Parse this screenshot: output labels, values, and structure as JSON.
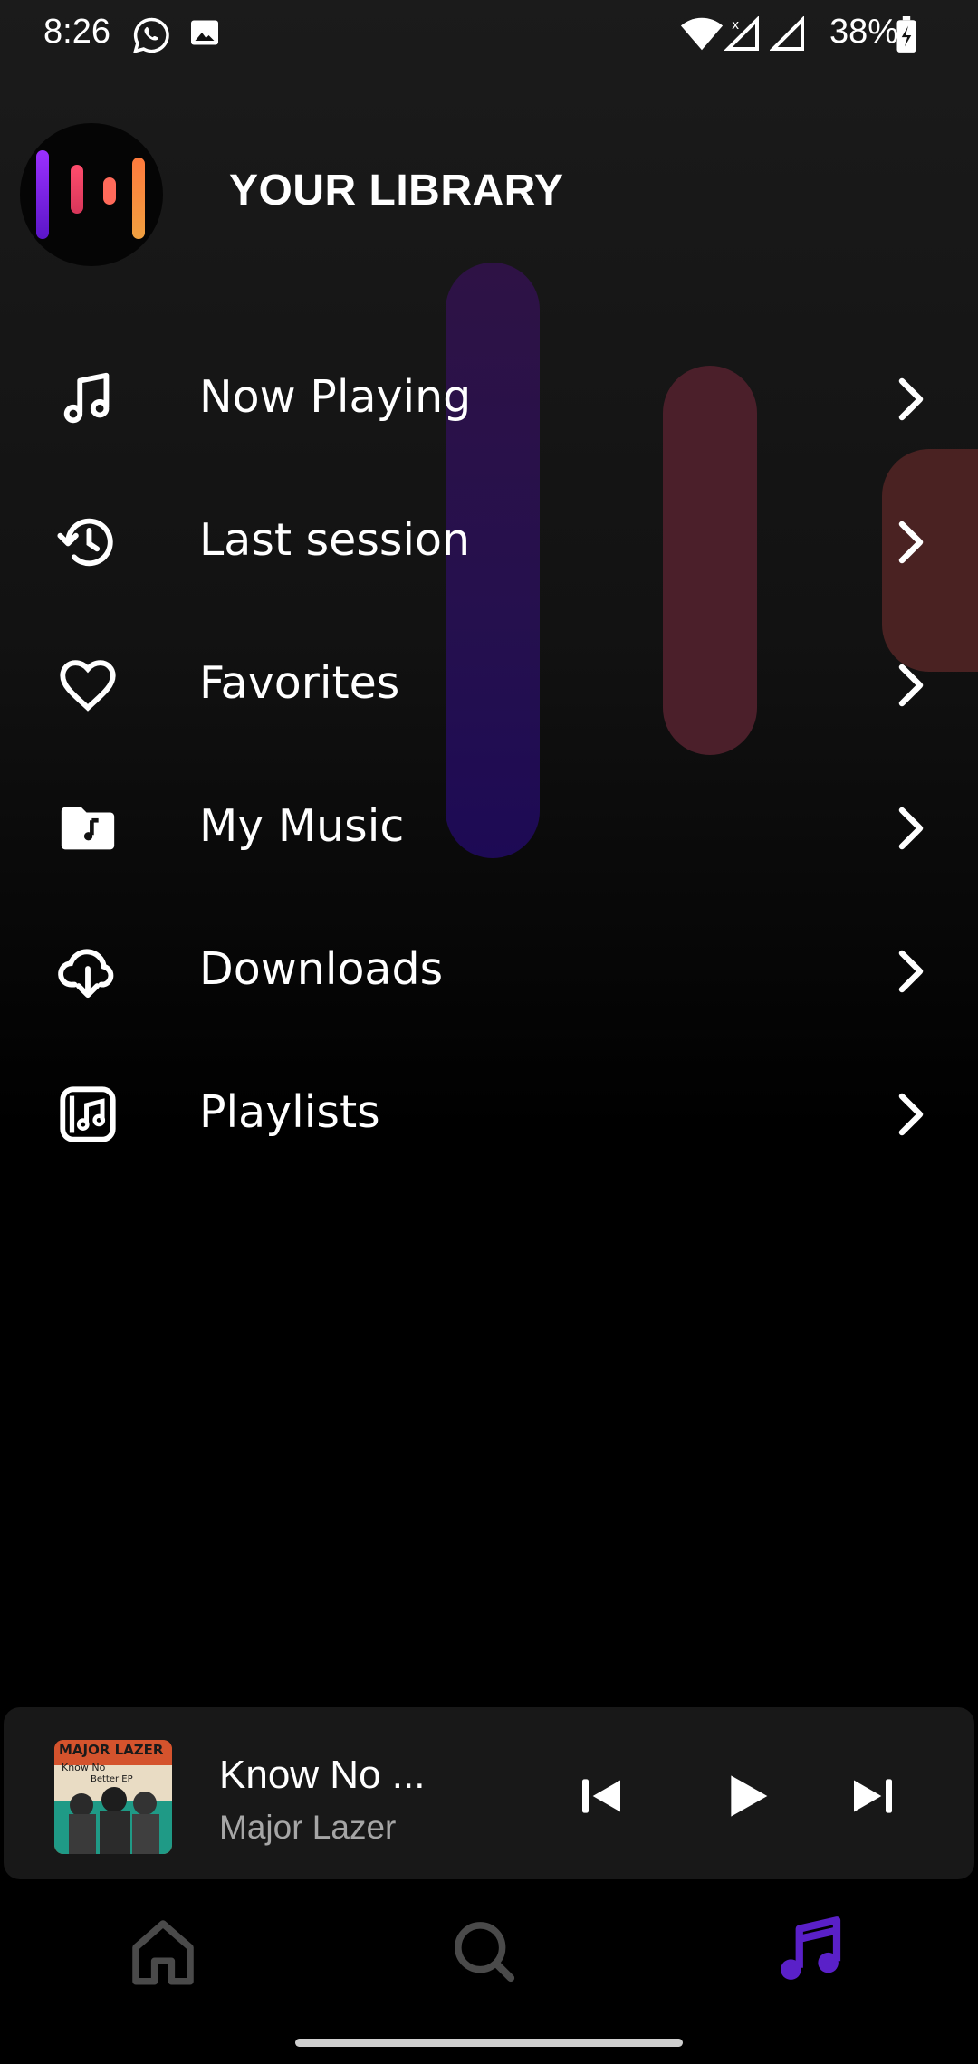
{
  "status_bar": {
    "time": "8:26",
    "battery": "38%",
    "icons": [
      "whatsapp-icon",
      "image-icon",
      "wifi-icon",
      "signal-icon",
      "signal-icon",
      "battery-charging-icon"
    ]
  },
  "header": {
    "title": "YOUR LIBRARY",
    "logo": "app-logo-equalizer"
  },
  "menu": [
    {
      "label": "Now Playing",
      "icon": "music-note-icon"
    },
    {
      "label": "Last session",
      "icon": "history-icon"
    },
    {
      "label": "Favorites",
      "icon": "heart-icon"
    },
    {
      "label": "My Music",
      "icon": "music-folder-icon"
    },
    {
      "label": "Downloads",
      "icon": "cloud-download-icon"
    },
    {
      "label": "Playlists",
      "icon": "playlist-icon"
    }
  ],
  "mini_player": {
    "title": "Know No ...",
    "artist": "Major Lazer",
    "album_art_text": "MAJOR LAZER Know No Better EP"
  },
  "bottom_nav": {
    "items": [
      {
        "name": "home",
        "icon": "home-icon",
        "active": false
      },
      {
        "name": "search",
        "icon": "search-icon",
        "active": false
      },
      {
        "name": "library",
        "icon": "music-note-icon",
        "active": true
      }
    ]
  },
  "colors": {
    "accent": "#5a20c8",
    "background": "#000000",
    "inactive_icon": "#4a4a4a",
    "secondary_text": "#a6a6a6",
    "logo_gradient": [
      "#8a2be2",
      "#e84a6a",
      "#f08a3a"
    ]
  }
}
